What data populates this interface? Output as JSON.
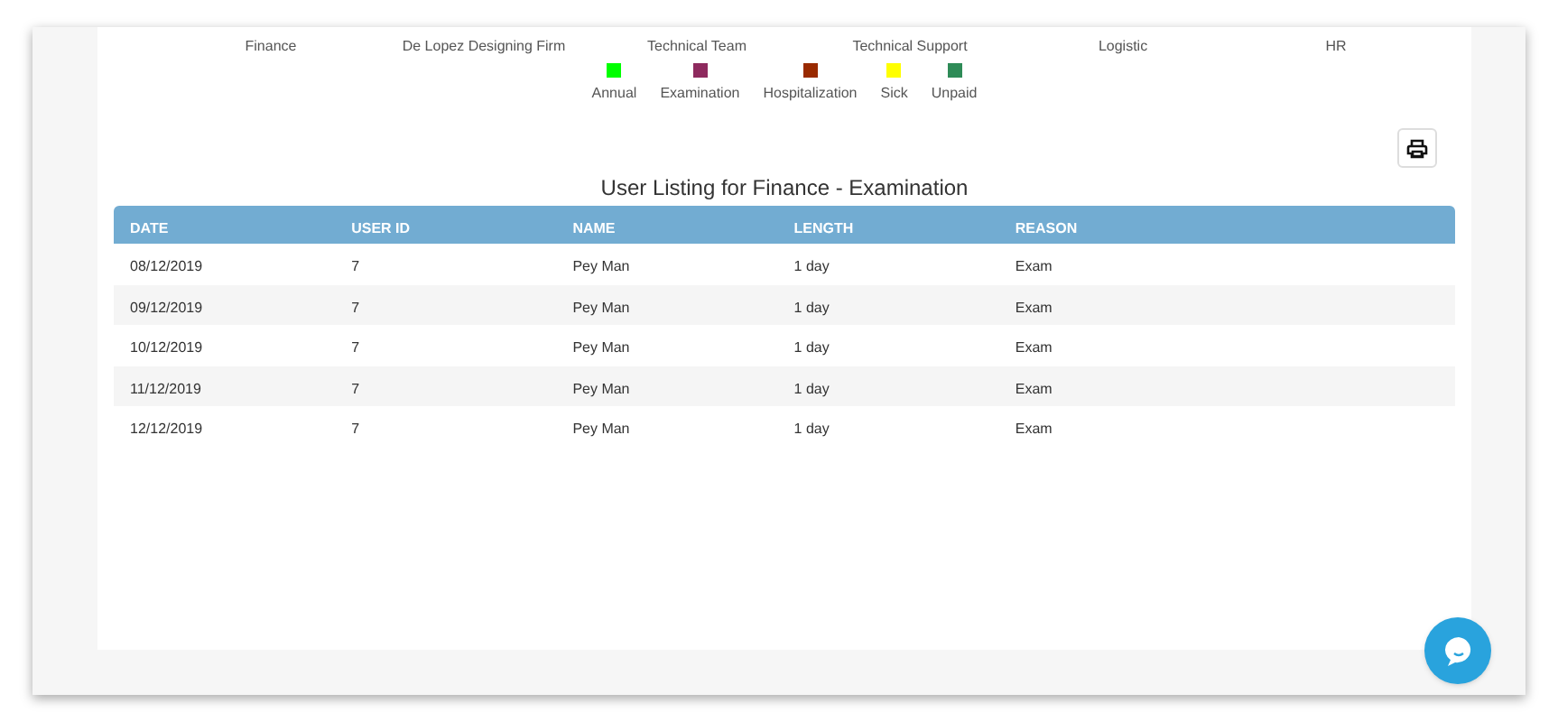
{
  "departments": [
    "Finance",
    "De Lopez Designing Firm",
    "Technical Team",
    "Technical Support",
    "Logistic",
    "HR"
  ],
  "legend": [
    {
      "label": "Annual",
      "color": "#00ff00"
    },
    {
      "label": "Examination",
      "color": "#8e2a5e"
    },
    {
      "label": "Hospitalization",
      "color": "#992a00"
    },
    {
      "label": "Sick",
      "color": "#ffff00"
    },
    {
      "label": "Unpaid",
      "color": "#2e8b57"
    }
  ],
  "title": "User Listing for Finance - Examination",
  "table": {
    "columns": [
      "DATE",
      "USER ID",
      "NAME",
      "LENGTH",
      "REASON"
    ],
    "rows": [
      [
        "08/12/2019",
        "7",
        "Pey Man",
        "1 day",
        "Exam"
      ],
      [
        "09/12/2019",
        "7",
        "Pey Man",
        "1 day",
        "Exam"
      ],
      [
        "10/12/2019",
        "7",
        "Pey Man",
        "1 day",
        "Exam"
      ],
      [
        "11/12/2019",
        "7",
        "Pey Man",
        "1 day",
        "Exam"
      ],
      [
        "12/12/2019",
        "7",
        "Pey Man",
        "1 day",
        "Exam"
      ]
    ]
  }
}
